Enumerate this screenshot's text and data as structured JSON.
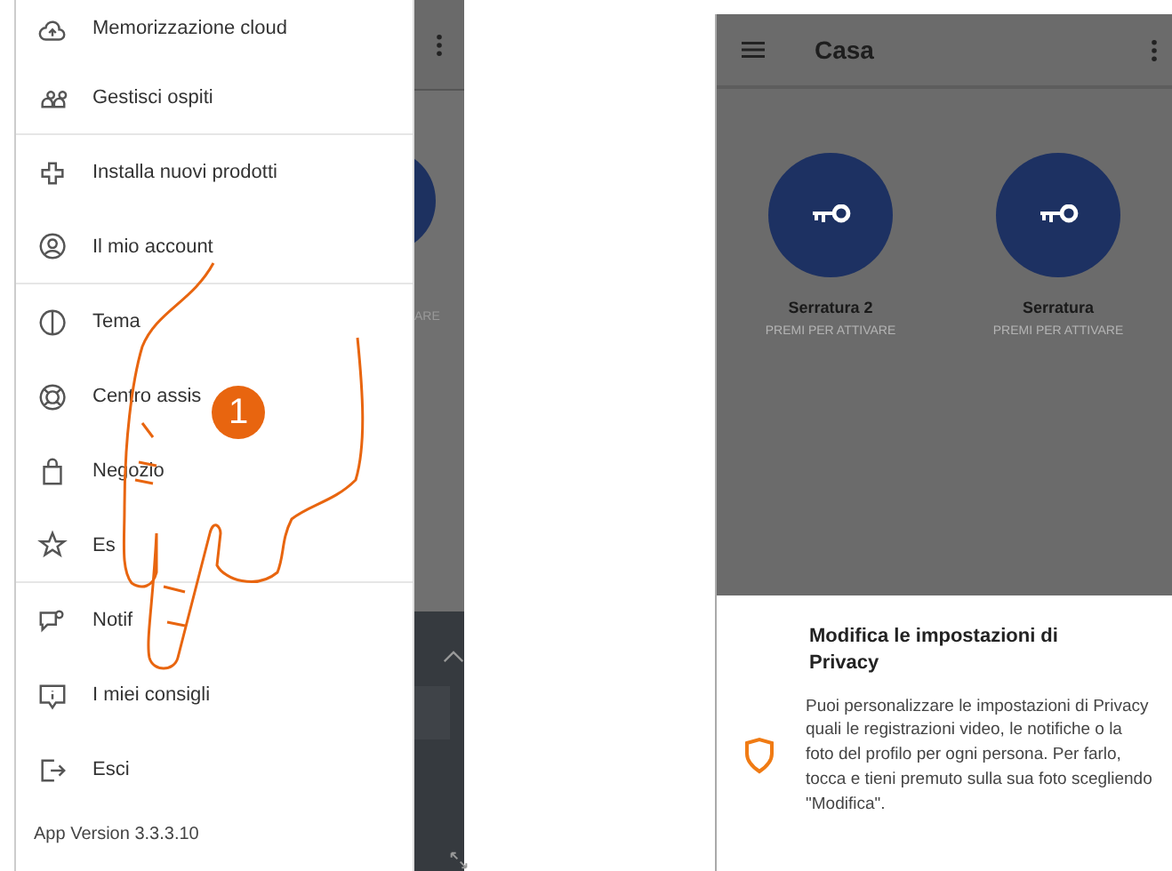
{
  "left_screen": {
    "menu_groups": [
      [
        {
          "label": "Memorizzazione cloud"
        },
        {
          "label": "Gestisci ospiti"
        }
      ],
      [
        {
          "label": "Installa nuovi prodotti"
        },
        {
          "label": "Il mio account"
        }
      ],
      [
        {
          "label": "Tema"
        },
        {
          "label": "Centro assis"
        },
        {
          "label": "Negozio"
        },
        {
          "label": "Es"
        }
      ],
      [
        {
          "label": "Notif"
        },
        {
          "label": "I miei consigli"
        },
        {
          "label": "Esci"
        }
      ]
    ],
    "app_version": "App Version 3.3.3.10",
    "background_label": "ARE"
  },
  "step_badge": "1",
  "right_screen": {
    "header": {
      "title": "Casa"
    },
    "devices": [
      {
        "name": "Serratura 2",
        "action": "PREMI PER ATTIVARE"
      },
      {
        "name": "Serratura",
        "action": "PREMI PER ATTIVARE"
      }
    ],
    "sheet": {
      "title": "Modifica le impostazioni di Privacy",
      "body": "Puoi personalizzare le impostazioni di Privacy quali le registrazioni video, le notifiche o la foto del profilo per ogni persona. Per farlo, tocca e tieni premuto sulla sua foto scegliendo \"Modifica\"."
    }
  }
}
